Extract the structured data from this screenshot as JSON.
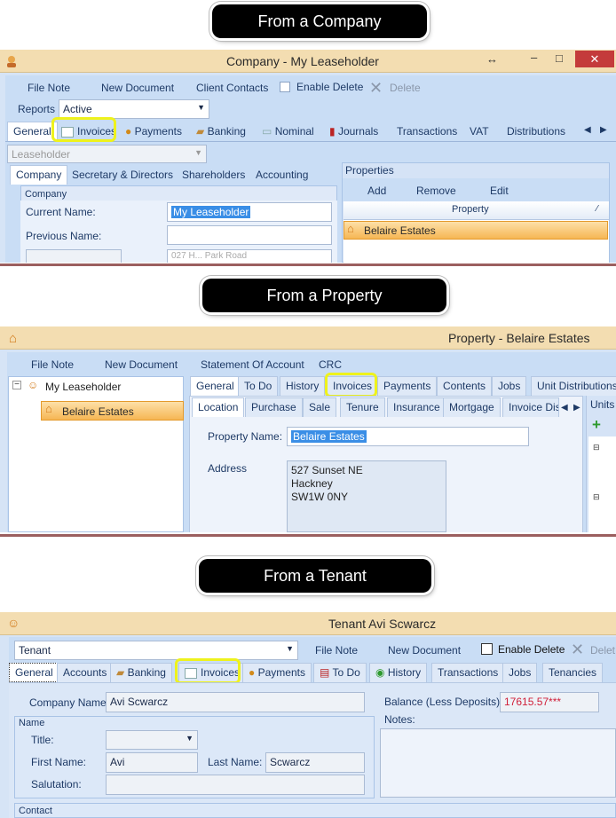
{
  "callouts": {
    "company": "From a Company",
    "property": "From a Property",
    "tenant": "From a Tenant"
  },
  "company": {
    "title": "Company - My Leaseholder",
    "toolbar": [
      "File Note",
      "New Document",
      "Client Contacts"
    ],
    "enable_delete": "Enable Delete",
    "delete": "Delete",
    "reports_label": "Reports",
    "reports_value": "Active",
    "tabs": [
      "General",
      "Invoices",
      "Payments",
      "Banking",
      "Nominal",
      "Journals",
      "Transactions",
      "VAT",
      "Distributions"
    ],
    "type_value": "Leaseholder",
    "subtabs": [
      "Company",
      "Secretary & Directors",
      "Shareholders",
      "Accounting"
    ],
    "group_title": "Company",
    "current_name_label": "Current Name:",
    "current_name": "My Leaseholder",
    "previous_name_label": "Previous Name:",
    "properties_title": "Properties",
    "prop_buttons": [
      "Add",
      "Remove",
      "Edit"
    ],
    "prop_column": "Property",
    "prop_row": "Belaire Estates",
    "cut_text": "027 H... Park Road"
  },
  "property": {
    "title": "Property - Belaire Estates",
    "toolbar": [
      "File Note",
      "New Document",
      "Statement Of Account",
      "CRC"
    ],
    "tree_root": "My Leaseholder",
    "tree_child": "Belaire Estates",
    "tabs": [
      "General",
      "To Do",
      "History",
      "Invoices",
      "Payments",
      "Contents",
      "Jobs",
      "Unit Distributions"
    ],
    "subtabs": [
      "Location",
      "Purchase",
      "Sale",
      "Tenure",
      "Insurance",
      "Mortgage",
      "Invoice Dis"
    ],
    "units_label": "Units",
    "property_name_label": "Property Name:",
    "property_name": "Belaire Estates",
    "address_label": "Address",
    "address_lines": [
      "527 Sunset NE",
      "Hackney",
      "SW1W 0NY"
    ]
  },
  "tenant": {
    "title": "Tenant Avi Scwarcz",
    "type_value": "Tenant",
    "toolbar": [
      "File Note",
      "New Document"
    ],
    "enable_delete": "Enable Delete",
    "delete": "Delet",
    "tabs": [
      "General",
      "Accounts",
      "Banking",
      "Invoices",
      "Payments",
      "To Do",
      "History",
      "Transactions",
      "Jobs",
      "Tenancies"
    ],
    "company_name_label": "Company Name",
    "company_name": "Avi Scwarcz",
    "balance_label": "Balance (Less Deposits):",
    "balance_value": "17615.57***",
    "notes_label": "Notes:",
    "name_group": "Name",
    "title_label": "Title:",
    "first_name_label": "First Name:",
    "first_name": "Avi",
    "last_name_label": "Last Name:",
    "last_name": "Scwarcz",
    "salutation_label": "Salutation:",
    "contact_group": "Contact"
  },
  "colors": {
    "highlight": "#eef21c",
    "selection": "#3a8ee6",
    "titlebar": "#f3ddb1",
    "balance": "#d0203a"
  }
}
